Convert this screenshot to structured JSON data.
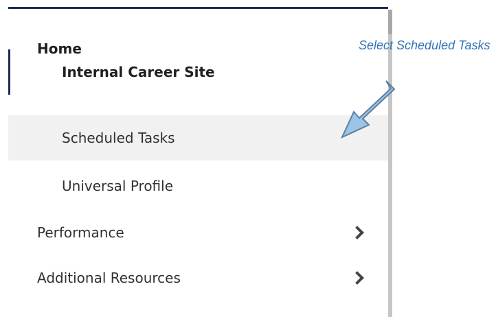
{
  "nav": {
    "home_label": "Home",
    "items": [
      {
        "label": "Internal Career Site"
      },
      {
        "label": "Scheduled Tasks"
      },
      {
        "label": "Universal Profile"
      },
      {
        "label": "Performance"
      },
      {
        "label": "Additional Resources"
      }
    ]
  },
  "annotation": {
    "text": "Select Scheduled Tasks"
  },
  "colors": {
    "accent": "#1b2d4e",
    "hover_background": "#f1f1f1",
    "callout": "#2e75b6",
    "arrow_fill": "#9dc3e6"
  },
  "icons": {
    "expand": "chevron-right-icon",
    "pointer": "arrow-callout-icon"
  }
}
